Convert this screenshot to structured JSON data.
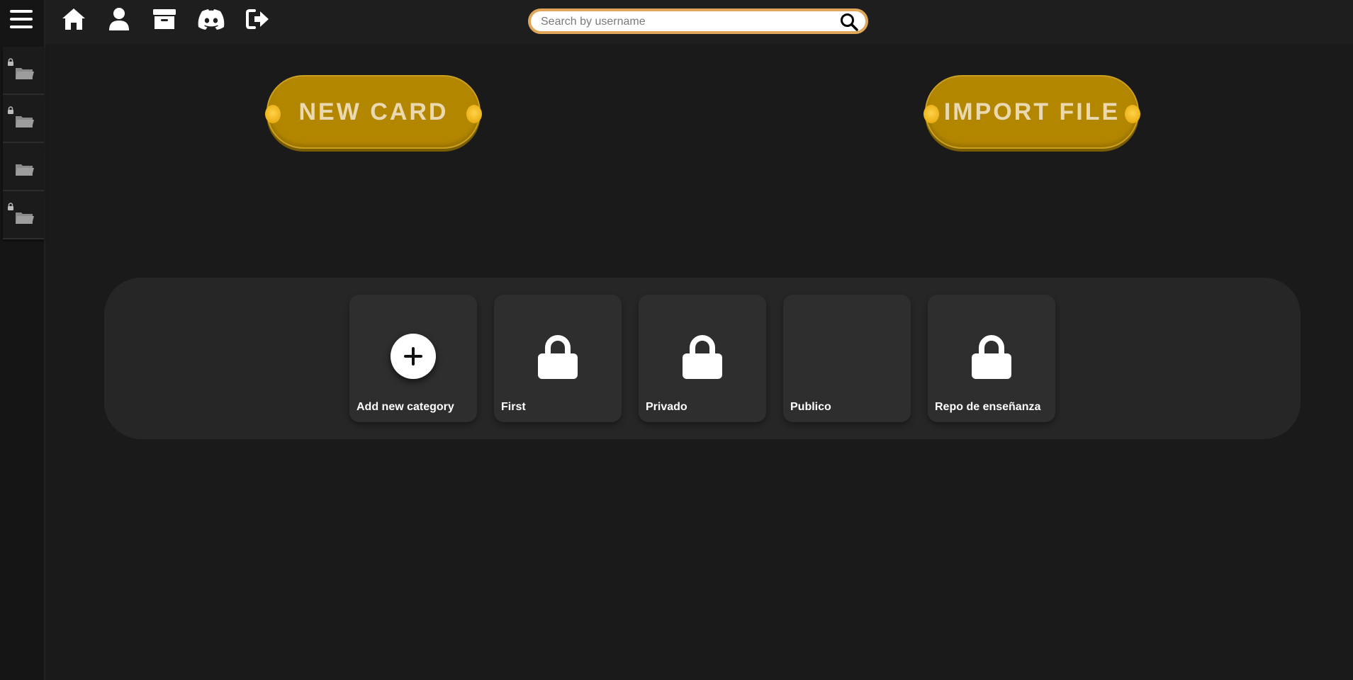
{
  "sidebar": {
    "menu_icon": "hamburger-menu-icon",
    "folders": [
      {
        "locked": true,
        "icon": "folder-icon"
      },
      {
        "locked": true,
        "icon": "folder-icon"
      },
      {
        "locked": false,
        "icon": "folder-icon"
      },
      {
        "locked": true,
        "icon": "folder-icon"
      }
    ]
  },
  "topbar": {
    "icons": [
      "home-icon",
      "user-icon",
      "archive-icon",
      "discord-icon",
      "logout-icon"
    ],
    "search": {
      "placeholder": "Search by username",
      "value": ""
    }
  },
  "actions": {
    "new_card_label": "NEW CARD",
    "import_file_label": "IMPORT FILE"
  },
  "categories": [
    {
      "label": "Add new category",
      "icon": "plus-icon"
    },
    {
      "label": "First",
      "icon": "lock-icon"
    },
    {
      "label": "Privado",
      "icon": "lock-icon"
    },
    {
      "label": "Publico",
      "icon": ""
    },
    {
      "label": "Repo de enseñanza",
      "icon": "lock-icon"
    }
  ],
  "colors": {
    "background": "#1a1a1a",
    "accent_gold": "#b38600",
    "search_border": "#e0a65a",
    "card": "#2e2e2e",
    "panel": "#262626"
  }
}
